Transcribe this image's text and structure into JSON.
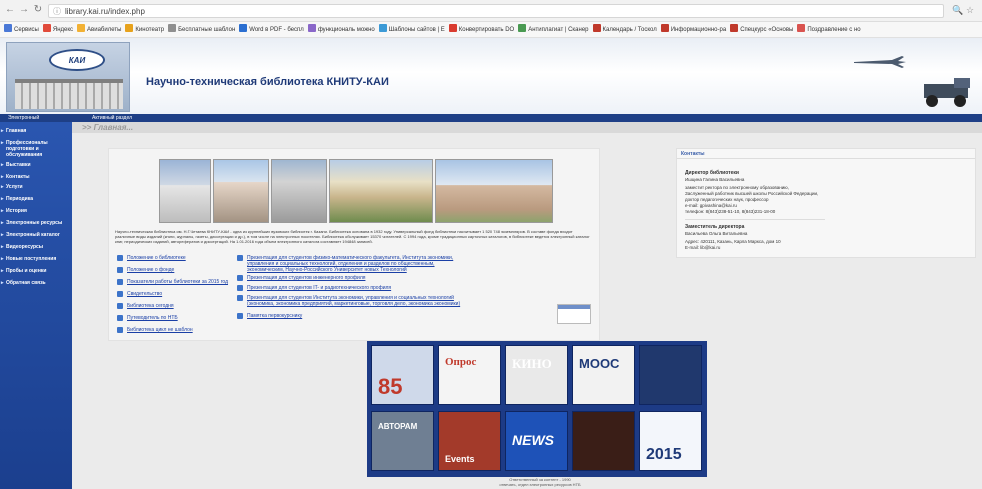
{
  "browser": {
    "url": "library.kai.ru/index.php",
    "bookmarks": [
      {
        "label": "Сервисы",
        "color": "#4a78d6"
      },
      {
        "label": "Яндекс",
        "color": "#e14b3b"
      },
      {
        "label": "Авиабилеты",
        "color": "#f2b134"
      },
      {
        "label": "Кинотеатр",
        "color": "#e7a21c"
      },
      {
        "label": "Бесплатные шаблон",
        "color": "#8f8f8f"
      },
      {
        "label": "Word в PDF - беспл",
        "color": "#2b6fd1"
      },
      {
        "label": "функциональ можно",
        "color": "#8a67c9"
      },
      {
        "label": "Шаблоны сайтов | E",
        "color": "#3c9ad6"
      },
      {
        "label": "Конвертировать DO",
        "color": "#d93b2f"
      },
      {
        "label": "Антиплагиат | Сканер",
        "color": "#4a9a52"
      },
      {
        "label": "Календарь / Тоскол",
        "color": "#c0392b"
      },
      {
        "label": "Информационно-ра",
        "color": "#c0392b"
      },
      {
        "label": "Спецкурс «Основы",
        "color": "#c0392b"
      },
      {
        "label": "Поздравление с но",
        "color": "#d9534f"
      }
    ]
  },
  "header": {
    "title": "Научно-техническая библиотека КНИТУ-КАИ",
    "logo_text": "КАИ"
  },
  "strip": {
    "left_label": "Электронный",
    "right_label": "Активный раздел"
  },
  "sidebar": {
    "items": [
      "Главная",
      "Профессионалы подготовки и обслуживания",
      "Выставки",
      "Контакты",
      "Услуги",
      "Периодика",
      "История",
      "Электронные ресурсы",
      "Электронный каталог",
      "Видеоресурсы",
      "Новые поступления",
      "Пробы и оценки",
      "Обратная связь"
    ]
  },
  "breadcrumb": ">> Главная...",
  "intro": "Научно-техническая библиотека им. Н.Г.Четаева КНИТУ-КАИ - одна из крупнейших вузовских библиотек г. Казани. Библиотека основана в 1932 году. Универсальный фонд библиотеки насчитывает 1 520 748 экземпляров. В составе фонда входят различные виды изданий (книги, журналы, газеты, диссертации и др.), в том числе на электронных носителях. Библиотека обслуживает 15370 читателей. С 1994 года, кроме традиционных карточных каталогов, в библиотеке ведется электронный каталог книг, периодических изданий, авторефератов и диссертаций. На 1.01.2016 года объем электронного каталога составляет 194848 записей.",
  "links_left": [
    "Положение о библиотеке",
    "Положение о фонде",
    "Показатели работы библиотеки за 2015 год",
    "Свидетельство",
    "Библиотека сегодня",
    "Путеводитель по НТБ",
    "Библиотека цикл не шаблон"
  ],
  "links_right": [
    "Презентация для студентов физико-математического факультета, Института экономики, управления и социальных технологий, отделения и разделов по общественным, экономическим, Научно-Российского Университет новых Технологий",
    "Презентация для студентов инженерного профиля",
    "Презентация для студентов IT- и радиотехнического профиля",
    "Презентация для студентов Института экономики, управления и социальных технологий (экономика, экономика предприятий, маркетинговые, торговля дело, экономика экономики)",
    "Памятка первокурснику"
  ],
  "contacts": {
    "header": "Контакты",
    "director_title": "Директор библиотеки",
    "director_name": "Ишцина Галина Васильевна",
    "director_lines": [
      "заместит ректора по электронному образованию,",
      "Заслуженный работник высшей школы Российской Федерации,",
      "доктор педагогических наук, профессор",
      "e-mail: gpivashina@kai.ru",
      "телефон: 8(843)238-51-10, 8(843)231-18-00"
    ],
    "deputy_title": "Заместитель директора",
    "deputy_name": "Васильева Ольга Витальевна",
    "deputy_lines": [
      "Адрес: 420111, Казань, Карла Маркса, дом 10",
      "E-mail: lib@kai.ru"
    ]
  },
  "tiles": [
    {
      "label": "85",
      "bg": "#cfd9ea",
      "fg": "#c0392b"
    },
    {
      "label": "Опрос",
      "bg": "#f4f4f4",
      "fg": "#c0392b"
    },
    {
      "label": "КИНО",
      "bg": "#e9e9e9",
      "fg": "#ffffff"
    },
    {
      "label": "MOOC",
      "bg": "#f2f2f2",
      "fg": "#1f3a78"
    },
    {
      "label": "",
      "bg": "#20386d",
      "fg": "#ffffff"
    },
    {
      "label": "АВТОРАМ",
      "bg": "#6f7f93",
      "fg": "#ffffff"
    },
    {
      "label": "Events",
      "bg": "#a33a2a",
      "fg": "#ffffff"
    },
    {
      "label": "NEWS",
      "bg": "#1e52b8",
      "fg": "#ffffff"
    },
    {
      "label": "",
      "bg": "#3a1e17",
      "fg": "#f0c040"
    },
    {
      "label": "2015",
      "bg": "#f3f6fb",
      "fg": "#1f3a78"
    }
  ],
  "footer": [
    "Ответственный за контент - 1990",
    "отвечать, отдел электронных ресурсов НТБ"
  ]
}
